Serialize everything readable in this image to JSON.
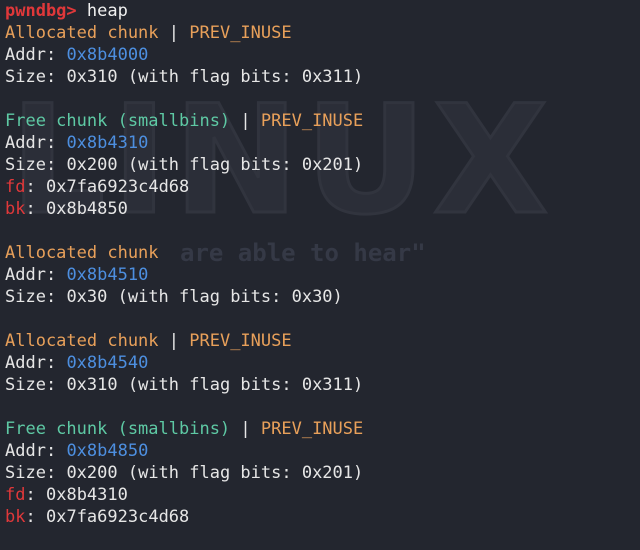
{
  "prompt": {
    "name": "pwndbg>",
    "command": "heap"
  },
  "labels": {
    "addr": "Addr:",
    "size": "Size:",
    "fd": "fd",
    "bk": "bk",
    "colon": ":",
    "pipe": " | ",
    "allocated": "Allocated chunk",
    "free": "Free chunk (smallbins)",
    "prev_inuse": "PREV_INUSE"
  },
  "chunks": [
    {
      "addr": "0x8b4000",
      "size": "0x310 (with flag bits: 0x311)"
    },
    {
      "addr": "0x8b4310",
      "size": "0x200 (with flag bits: 0x201)",
      "fd": "0x7fa6923c4d68",
      "bk": "0x8b4850"
    },
    {
      "addr": "0x8b4510",
      "size": "0x30 (with flag bits: 0x30)"
    },
    {
      "addr": "0x8b4540",
      "size": "0x310 (with flag bits: 0x311)"
    },
    {
      "addr": "0x8b4850",
      "size": "0x200 (with flag bits: 0x201)",
      "fd": "0x8b4310",
      "bk": "0x7fa6923c4d68"
    }
  ],
  "wallpaper": {
    "brand": "LINUX",
    "tagline": "are able to hear\""
  },
  "colors": {
    "background": "#23262f",
    "prompt": "#e0383a",
    "allocated": "#e8a05a",
    "free": "#5ec9a4",
    "address": "#4d8fe0",
    "pointer_label": "#e0383a",
    "text": "#e6e6e6"
  }
}
